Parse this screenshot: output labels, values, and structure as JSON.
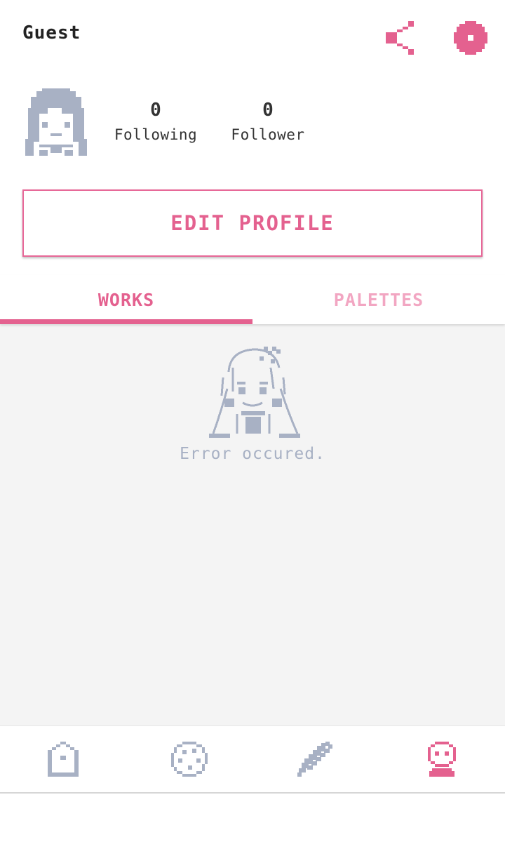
{
  "header": {
    "title": "Guest",
    "share_icon": "share-icon",
    "settings_icon": "gear-icon"
  },
  "profile": {
    "avatar_icon": "pixel-avatar-icon",
    "following": {
      "count": "0",
      "label": "Following"
    },
    "follower": {
      "count": "0",
      "label": "Follower"
    },
    "edit_button": "EDIT PROFILE"
  },
  "tabs": [
    {
      "label": "WORKS",
      "active": true
    },
    {
      "label": "PALETTES",
      "active": false
    }
  ],
  "content": {
    "error_message": "Error occured.",
    "error_icon": "broken-character-icon"
  },
  "bottom_nav": [
    {
      "icon": "home-icon",
      "active": false
    },
    {
      "icon": "palette-icon",
      "active": false
    },
    {
      "icon": "pencil-icon",
      "active": false
    },
    {
      "icon": "profile-icon",
      "active": true
    }
  ],
  "colors": {
    "accent": "#e4618f",
    "accent_light": "#f2a6c2",
    "muted": "#a8b1c4",
    "background": "#f4f4f4"
  }
}
